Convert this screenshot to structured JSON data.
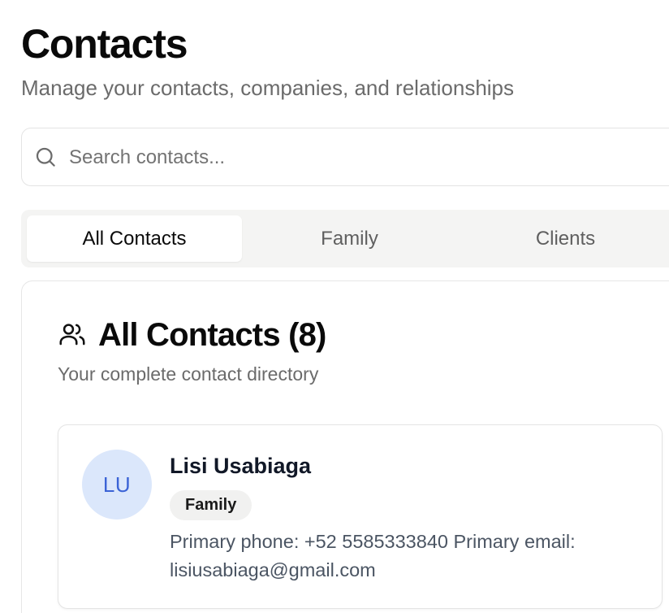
{
  "header": {
    "title": "Contacts",
    "subtitle": "Manage your contacts, companies, and relationships"
  },
  "search": {
    "placeholder": "Search contacts...",
    "value": "",
    "icon": "search-icon"
  },
  "tabs": [
    {
      "label": "All Contacts",
      "active": true
    },
    {
      "label": "Family",
      "active": false
    },
    {
      "label": "Clients",
      "active": false
    }
  ],
  "panel": {
    "icon": "users-icon",
    "title": "All Contacts (8)",
    "subtitle": "Your complete contact directory"
  },
  "contacts": [
    {
      "initials": "LU",
      "name": "Lisi Usabiaga",
      "badge": "Family",
      "details": "Primary phone: +52 5585333840 Primary email: lisiusabiaga@gmail.com"
    }
  ],
  "colors": {
    "avatar_bg": "#dbe7fb",
    "avatar_text": "#3b63d6",
    "tab_bar_bg": "#f4f4f3",
    "muted_text": "#6b6b6b"
  }
}
